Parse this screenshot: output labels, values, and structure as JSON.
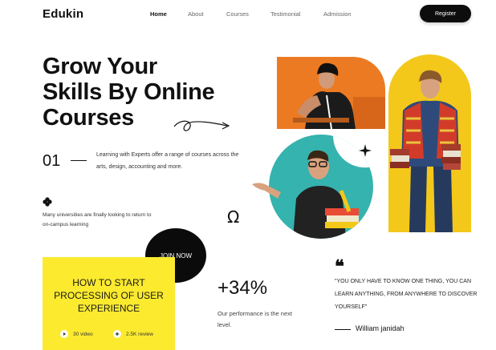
{
  "brand": {
    "name": "Edukin"
  },
  "nav": {
    "items": [
      {
        "label": "Home",
        "active": true
      },
      {
        "label": "About",
        "active": false
      },
      {
        "label": "Courses",
        "active": false
      },
      {
        "label": "Testimonial",
        "active": false
      },
      {
        "label": "Admission",
        "active": false
      }
    ],
    "register_label": "Register"
  },
  "hero": {
    "title_line1": "Grow Your",
    "title_line2": "Skills By Online",
    "title_line3": "Courses",
    "step_number": "01",
    "step_text": "Learning with Experts offer a range of courses across the arts, design, accounting and more.",
    "small_text": "Many universities are finally looking to return to on-campus learning"
  },
  "join": {
    "label": "JOIN NOW"
  },
  "card": {
    "title": "HOW TO START PROCESSING OF USER EXPERIENCE",
    "videos": "30 video",
    "reviews": "2.5K review"
  },
  "stats": {
    "value": "+34%",
    "label": "Our performance is the next level."
  },
  "quote": {
    "text": "\"YOU ONLY HAVE TO KNOW ONE THING, YOU CAN LEARN ANYTHING, FROM ANYWHERE TO DISCOVER YOURSELF\"",
    "author": "William janidah"
  },
  "icons": [
    "arrow-squiggle-icon",
    "flower-icon",
    "star-icon",
    "omega-icon",
    "quote-icon",
    "play-icon",
    "star-badge-icon"
  ],
  "colors": {
    "accent_yellow": "#fbea2e",
    "orange": "#ec7a22",
    "teal": "#35b3ae",
    "mustard": "#f3c81b",
    "dark": "#0d0d0d"
  }
}
